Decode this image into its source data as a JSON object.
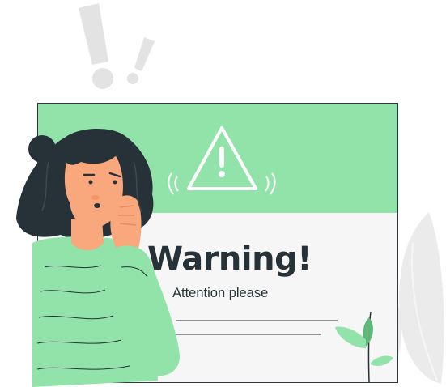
{
  "warning": {
    "title": "Warning!",
    "subtitle": "Attention please"
  },
  "icons": {
    "alert": "warning-triangle-icon",
    "exclamation": "exclamation-mark-icon"
  },
  "colors": {
    "header_green": "#92e3a9",
    "panel_bg": "#f6f6f6",
    "text_dark": "#263238",
    "exclamation_gray": "#e0e0e0",
    "leaf_gray": "#ebebeb"
  }
}
